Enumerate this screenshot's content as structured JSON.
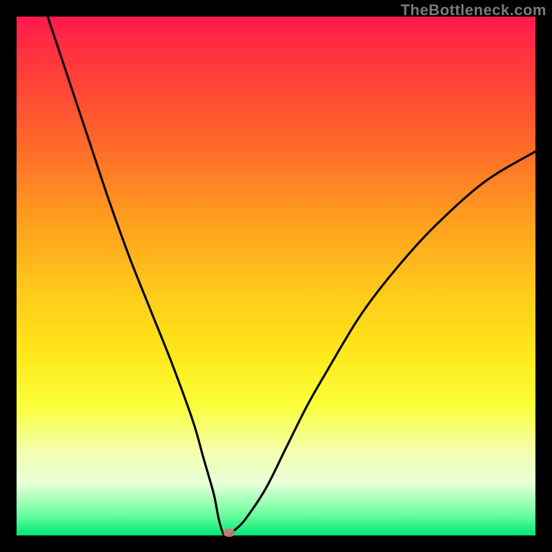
{
  "watermark": "TheBottleneck.com",
  "colors": {
    "frame": "#000000",
    "curve": "#000000",
    "marker": "#c77b7b",
    "gradient_top": "#ff1a4d",
    "gradient_bottom": "#00e676"
  },
  "chart_data": {
    "type": "line",
    "title": "",
    "xlabel": "",
    "ylabel": "",
    "xlim": [
      0,
      100
    ],
    "ylim": [
      0,
      100
    ],
    "grid": false,
    "legend": false,
    "notes": "V-shaped bottleneck curve; y-axis color gradient encodes severity (red=high at top, green=low at bottom). Minimum near x≈40. No numeric tick labels visible.",
    "series": [
      {
        "name": "bottleneck-curve",
        "x": [
          6,
          10,
          14,
          18,
          22,
          26,
          30,
          34,
          36,
          38,
          39,
          40,
          41,
          42,
          44,
          48,
          52,
          56,
          60,
          66,
          72,
          80,
          90,
          100
        ],
        "y": [
          100,
          88,
          76,
          64,
          53,
          43,
          33,
          22,
          15,
          8,
          3,
          0,
          0,
          1,
          3,
          9,
          17,
          25,
          32,
          42,
          50,
          59,
          68,
          74
        ]
      }
    ],
    "marker": {
      "x": 41,
      "y": 0
    }
  }
}
